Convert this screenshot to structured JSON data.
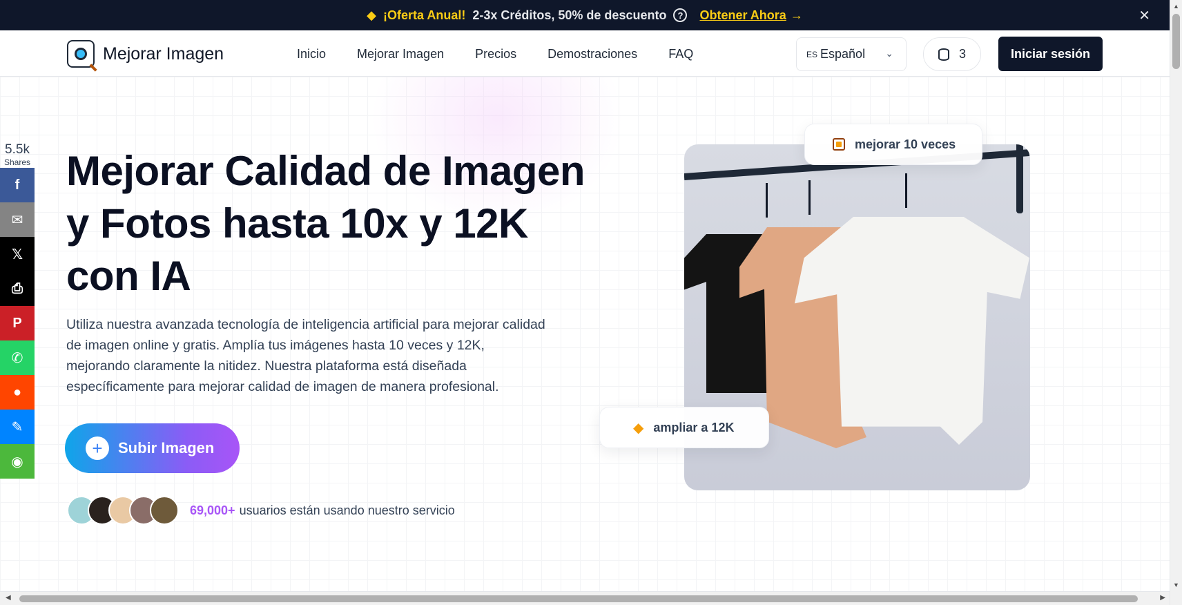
{
  "promo": {
    "offer": "¡Oferta Anual!",
    "description": "2-3x Créditos, 50% de descuento",
    "cta": "Obtener Ahora",
    "help_symbol": "?",
    "close_symbol": "✕"
  },
  "header": {
    "logo_text": "Mejorar Imagen",
    "nav": [
      "Inicio",
      "Mejorar Imagen",
      "Precios",
      "Demostraciones",
      "FAQ"
    ],
    "language": {
      "code": "ES",
      "label": "Español"
    },
    "credits": "3",
    "login_label": "Iniciar sesión"
  },
  "share": {
    "count": "5.5k",
    "label": "Shares",
    "buttons": [
      {
        "name": "facebook",
        "glyph": "f",
        "color": "#3b5998"
      },
      {
        "name": "email",
        "glyph": "✉",
        "color": "#848484"
      },
      {
        "name": "x",
        "glyph": "𝕏",
        "color": "#000000"
      },
      {
        "name": "print",
        "glyph": "⎙",
        "color": "#000000"
      },
      {
        "name": "pinterest",
        "glyph": "P",
        "color": "#cb2027"
      },
      {
        "name": "whatsapp",
        "glyph": "✆",
        "color": "#25d366"
      },
      {
        "name": "reddit",
        "glyph": "●",
        "color": "#ff4500"
      },
      {
        "name": "messenger",
        "glyph": "✎",
        "color": "#0084ff"
      },
      {
        "name": "wechat",
        "glyph": "◉",
        "color": "#4cb83c"
      }
    ]
  },
  "hero": {
    "title": "Mejorar Calidad de Imagen y Fotos hasta 10x y 12K con IA",
    "description": "Utiliza nuestra avanzada tecnología de inteligencia artificial para mejorar calidad de imagen online y gratis. Amplía tus imágenes hasta 10 veces y 12K, mejorando claramente la nitidez. Nuestra plataforma está diseñada específicamente para mejorar calidad de imagen de manera profesional.",
    "upload_label": "Subir Imagen",
    "users_count": "69,000+",
    "users_text": "usuarios están usando nuestro servicio",
    "badge_top": "mejorar 10 veces",
    "badge_bottom": "ampliar a 12K"
  },
  "colors": {
    "accent_purple": "#a855f7",
    "accent_yellow": "#facc15",
    "dark": "#0f172a"
  }
}
